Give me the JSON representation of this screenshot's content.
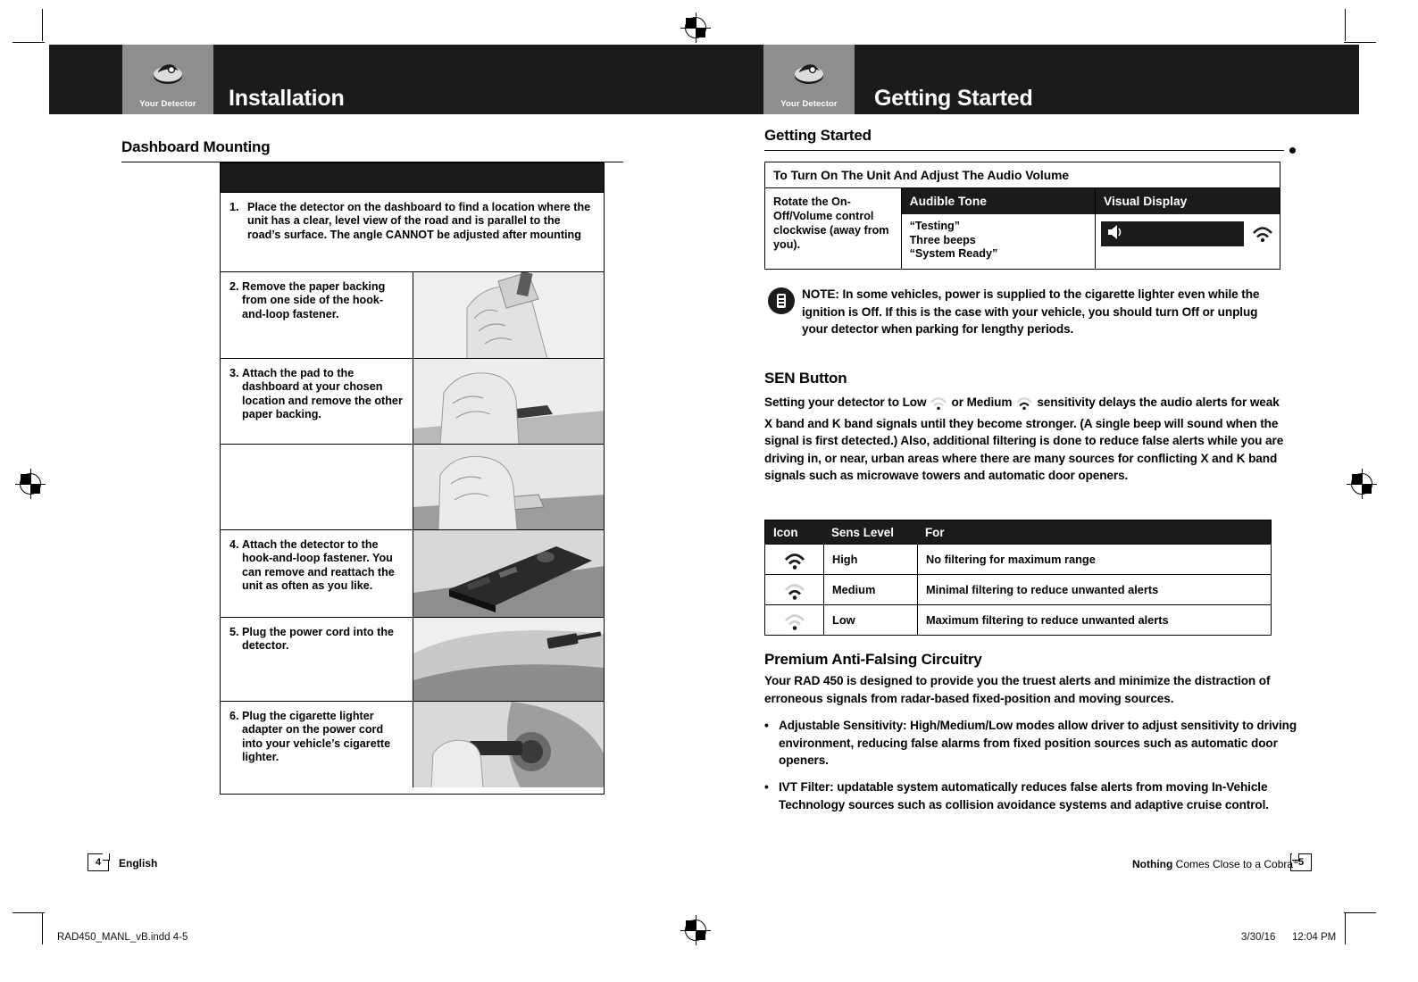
{
  "left_page": {
    "banner": {
      "tab_label": "Your Detector",
      "tab_icon": "detector-icon",
      "title": "Installation"
    },
    "section_title": "Dashboard Mounting",
    "steps": [
      {
        "num": "1.",
        "text_parts": [
          {
            "t": "Place the detector on the dashboard to find a location where the unit has a clear, level view of the road ",
            "b": false
          },
          {
            "t": "and is parallel to the road’s surface.",
            "b": true
          },
          {
            "t": " The angle CANNOT be adjusted after mounting",
            "b": false
          }
        ],
        "has_image": false
      },
      {
        "num": "2.",
        "text": "Remove the paper backing from one side of the hook-and-loop fastener.",
        "has_image": true,
        "image_name": "hand-peeling-fastener-photo"
      },
      {
        "num": "3.",
        "text": "Attach the pad to the dashboard at your chosen location and remove the other paper backing.",
        "has_image": true,
        "image_name": "hand-attaching-pad-photo"
      },
      {
        "num": "",
        "text": "",
        "has_image": true,
        "image_name": "hand-removing-backing-photo"
      },
      {
        "num": "4.",
        "text": "Attach the detector to the hook-and-loop fastener. You can remove and reattach the unit as often as you like.",
        "has_image": true,
        "image_name": "detector-on-dashboard-photo"
      },
      {
        "num": "5.",
        "text": "Plug the power cord into the detector.",
        "has_image": true,
        "image_name": "power-cord-plug-photo"
      },
      {
        "num": "6.",
        "text": "Plug the cigarette lighter adapter on the power cord into your vehicle’s cigarette lighter.",
        "has_image": true,
        "image_name": "cigarette-lighter-photo"
      }
    ],
    "footer": {
      "page_number": "4",
      "language": "English"
    }
  },
  "right_page": {
    "banner": {
      "tab_label": "Your Detector",
      "tab_icon": "detector-icon",
      "title": "Getting Started"
    },
    "section_title": "Getting Started",
    "audio_table": {
      "title": "To Turn On The Unit And Adjust The Audio Volume",
      "row_label_parts": [
        {
          "t": "Rotate the ",
          "b": false
        },
        {
          "t": "On-Off/Volume",
          "b": true
        },
        {
          "t": " control clockwise (away from you).",
          "b": false
        }
      ],
      "col_audible": "Audible Tone",
      "col_visual": "Visual Display",
      "audible_lines": [
        "“Testing”",
        "Three beeps",
        "“System Ready”"
      ],
      "visual_display": "volume-bar-display"
    },
    "note": {
      "label": "NOTE:",
      "text": " In some vehicles, power is supplied to the cigarette lighter even while the ignition is Off. If this is the case with your vehicle, you should turn Off or unplug your detector when parking for lengthy periods."
    },
    "sen": {
      "heading": "SEN Button",
      "paragraph_parts": [
        {
          "t": "Setting your detector to ",
          "b": false
        },
        {
          "t": "Low",
          "b": true
        },
        {
          "t": " ICON1 ",
          "b": false
        },
        {
          "t": "or ",
          "b": false
        },
        {
          "t": "Medium",
          "b": true
        },
        {
          "t": " ICON2 ",
          "b": false
        },
        {
          "t": "sensitivity delays the audio alerts for weak X band and K band signals until they become stronger. (A single beep will sound when the signal is first detected.)  Also, additional filtering is done to reduce false alerts while you are driving in, or near, urban areas where there are many sources for conflicting X and K band signals such as microwave towers and automatic door openers.",
          "b": false
        }
      ]
    },
    "sens_table": {
      "headers": [
        "Icon",
        "Sens Level",
        "For"
      ],
      "rows": [
        {
          "icon": "signal-high-icon",
          "level": "High",
          "for": "No filtering for maximum range"
        },
        {
          "icon": "signal-medium-icon",
          "level": "Medium",
          "for": "Minimal filtering to reduce unwanted alerts"
        },
        {
          "icon": "signal-low-icon",
          "level": "Low",
          "for": "Maximum filtering to reduce unwanted alerts"
        }
      ]
    },
    "premium": {
      "heading": "Premium Anti-Falsing Circuitry",
      "paragraph": "Your RAD 450 is designed to provide you the truest alerts and minimize the distraction of erroneous signals from radar-based fixed-position and moving sources.",
      "bullets": [
        {
          "marker": "•",
          "bold": "Adjustable Sensitivity:",
          "rest": " High/Medium/Low modes allow driver to adjust sensitivity to driving environment, reducing false alarms from fixed position sources such as automatic door openers."
        },
        {
          "marker": "•",
          "bold": "IVT Filter:",
          "rest": " updatable system automatically reduces false alerts from moving In-Vehicle Technology sources such as collision avoidance systems and adaptive cruise control."
        }
      ]
    },
    "footer": {
      "tagline_bold": "Nothing",
      "tagline_rest": " Comes Close to a Cobra",
      "tagline_reg": "®",
      "page_number": "5"
    }
  },
  "print_meta": {
    "filename": "RAD450_MANL_vB.indd   4-5",
    "date": "3/30/16",
    "time": "12:04 PM"
  },
  "colors": {
    "banner": "#1b1b1b",
    "tab": "#8e8e8e",
    "paper": "#ffffff"
  }
}
